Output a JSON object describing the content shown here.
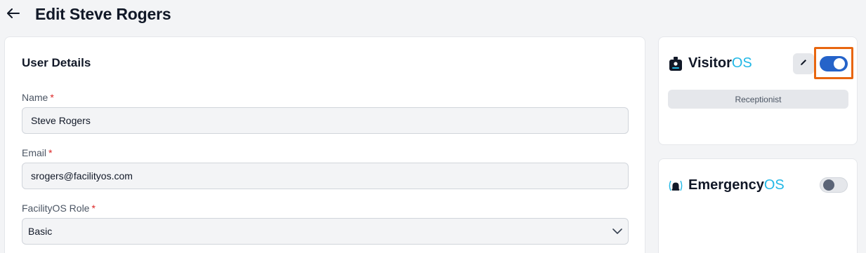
{
  "header": {
    "back_icon": "arrow-left-icon",
    "title": "Edit Steve Rogers"
  },
  "user_details": {
    "section_title": "User Details",
    "required_mark": "*",
    "name": {
      "label": "Name",
      "value": "Steve Rogers"
    },
    "email": {
      "label": "Email",
      "value": "srogers@facilityos.com"
    },
    "role": {
      "label": "FacilityOS Role",
      "value": "Basic"
    }
  },
  "apps": {
    "visitor": {
      "name": "Visitor",
      "suffix": "OS",
      "icon": "badge-icon",
      "enabled": true,
      "role_label": "Receptionist"
    },
    "emergency": {
      "name": "Emergency",
      "suffix": "OS",
      "icon": "alarm-icon",
      "enabled": false
    }
  },
  "colors": {
    "accent_os": "#22b8e6",
    "toggle_on": "#2563c9",
    "highlight": "#e8660f",
    "required": "#dc2626"
  }
}
